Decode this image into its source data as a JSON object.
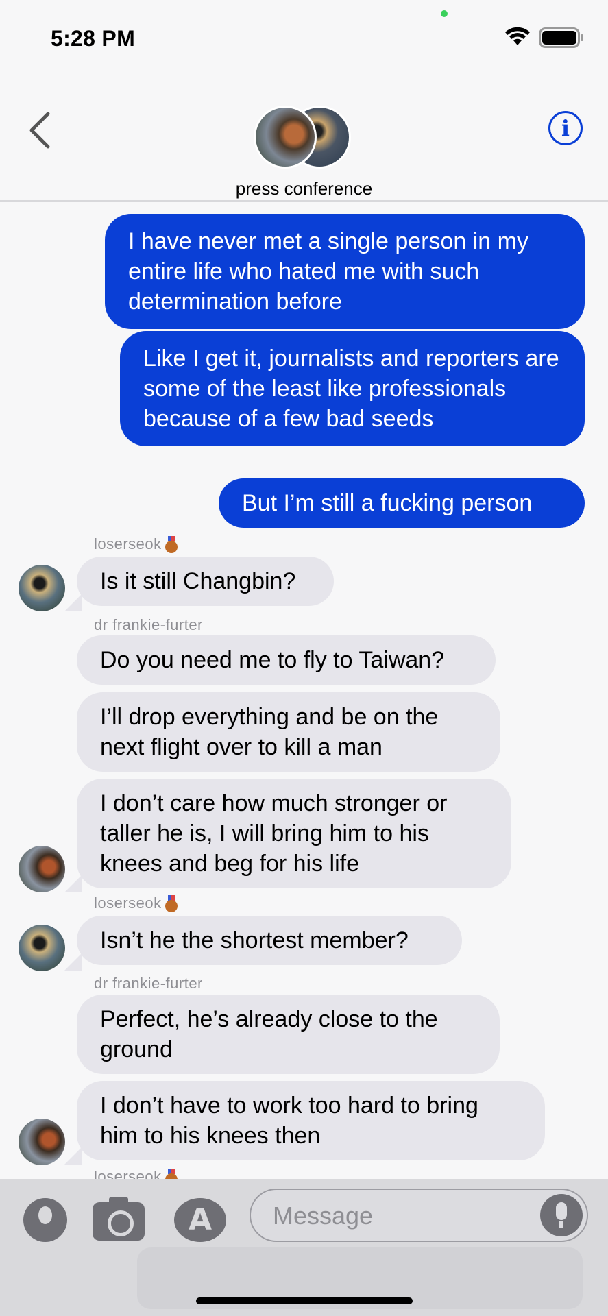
{
  "status_bar": {
    "time": "5:28 PM"
  },
  "header": {
    "group_name": "press conference",
    "info_label": "i"
  },
  "thread": {
    "outgoing": [
      "I have never met a single person in my entire life who hated me with such determination before",
      "Like I get it, journalists and reporters are some of the least like professionals because of a few bad seeds",
      "But I’m still a fucking person"
    ],
    "senders": {
      "loserseok": "loserseok",
      "frankie": "dr frankie-furter"
    },
    "incoming": [
      "Is it still Changbin?",
      "Do you need me to fly to Taiwan?",
      "I’ll drop everything and be on the next flight over to kill a man",
      "I don’t care how much stronger or taller he is, I will bring him to his knees and beg for his life",
      "Isn’t he the shortest member?",
      "Perfect, he’s already close to the ground",
      "I don’t have to work too hard to bring him to his knees then"
    ]
  },
  "composer": {
    "placeholder": "Message"
  },
  "colors": {
    "accent": "#0a3fd6",
    "incoming_bubble": "#e6e5eb"
  }
}
